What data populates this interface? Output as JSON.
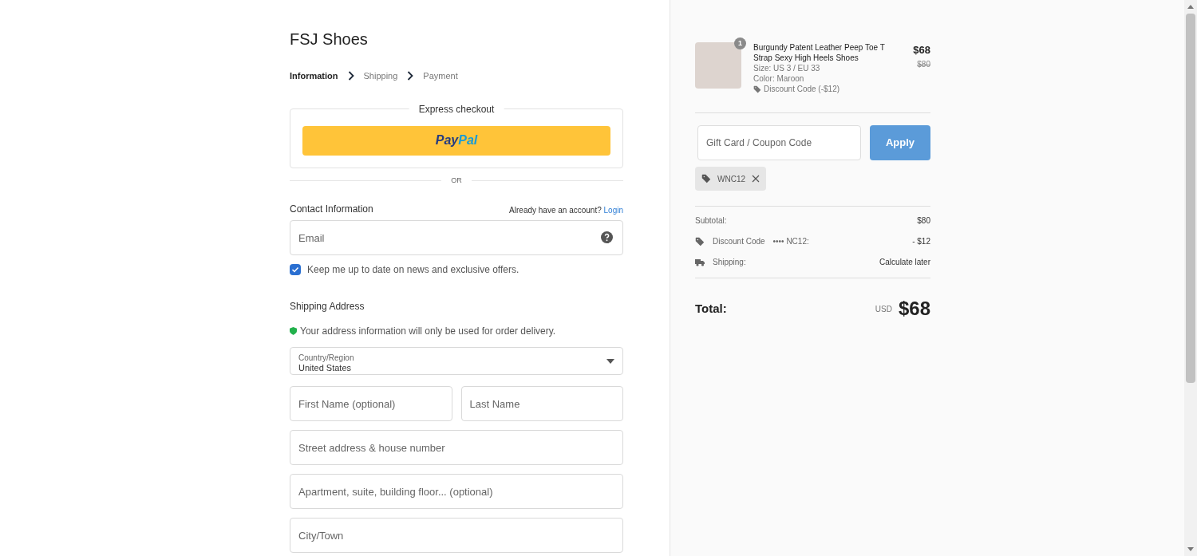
{
  "store": {
    "name": "FSJ Shoes"
  },
  "breadcrumbs": [
    {
      "label": "Information",
      "selected": true
    },
    {
      "label": "Shipping",
      "selected": false
    },
    {
      "label": "Payment",
      "selected": false
    }
  ],
  "express": {
    "title": "Express checkout",
    "paypal": {
      "pay": "Pay",
      "pal": "Pal"
    },
    "separator": "OR"
  },
  "contact": {
    "title": "Contact Information",
    "account_prompt": "Already have an account?",
    "login": "Login",
    "email": {
      "placeholder": "Email"
    },
    "newsletter": {
      "label": "Keep me up to date on news and exclusive offers.",
      "checked": true
    }
  },
  "shipping": {
    "title": "Shipping Address",
    "notice": "Your address information will only be used for order delivery.",
    "country": {
      "label": "Country/Region",
      "value": "United States"
    },
    "field_rows": [
      [
        {
          "placeholder": "First Name (optional)"
        },
        {
          "placeholder": "Last Name"
        }
      ],
      [
        {
          "placeholder": "Street address & house number"
        }
      ],
      [
        {
          "placeholder": "Apartment, suite, building floor... (optional)"
        }
      ],
      [
        {
          "placeholder": "City/Town"
        }
      ]
    ]
  },
  "cart": {
    "items": [
      {
        "quantity": "1",
        "name": "Burgundy Patent Leather Peep Toe T Strap Sexy High Heels Shoes",
        "size": "Size: US 3 / EU 33",
        "variant": "Color: Maroon",
        "discount": "Discount Code (-$12)",
        "price": "$68",
        "original_price": "$80"
      }
    ],
    "coupon": {
      "placeholder": "Gift Card / Coupon Code",
      "button": "Apply"
    },
    "applied_codes": [
      {
        "code": "WNC12"
      }
    ],
    "summary": [
      {
        "kind": "plain",
        "label": "Subtotal:",
        "value": "$80"
      },
      {
        "kind": "discount",
        "label": "Discount Code",
        "code": "•••• NC12:",
        "value": "- $12"
      },
      {
        "kind": "shipping",
        "label": "Shipping:",
        "value": "Calculate later"
      }
    ],
    "total": {
      "label": "Total:",
      "currency": "USD",
      "amount": "$68"
    }
  }
}
